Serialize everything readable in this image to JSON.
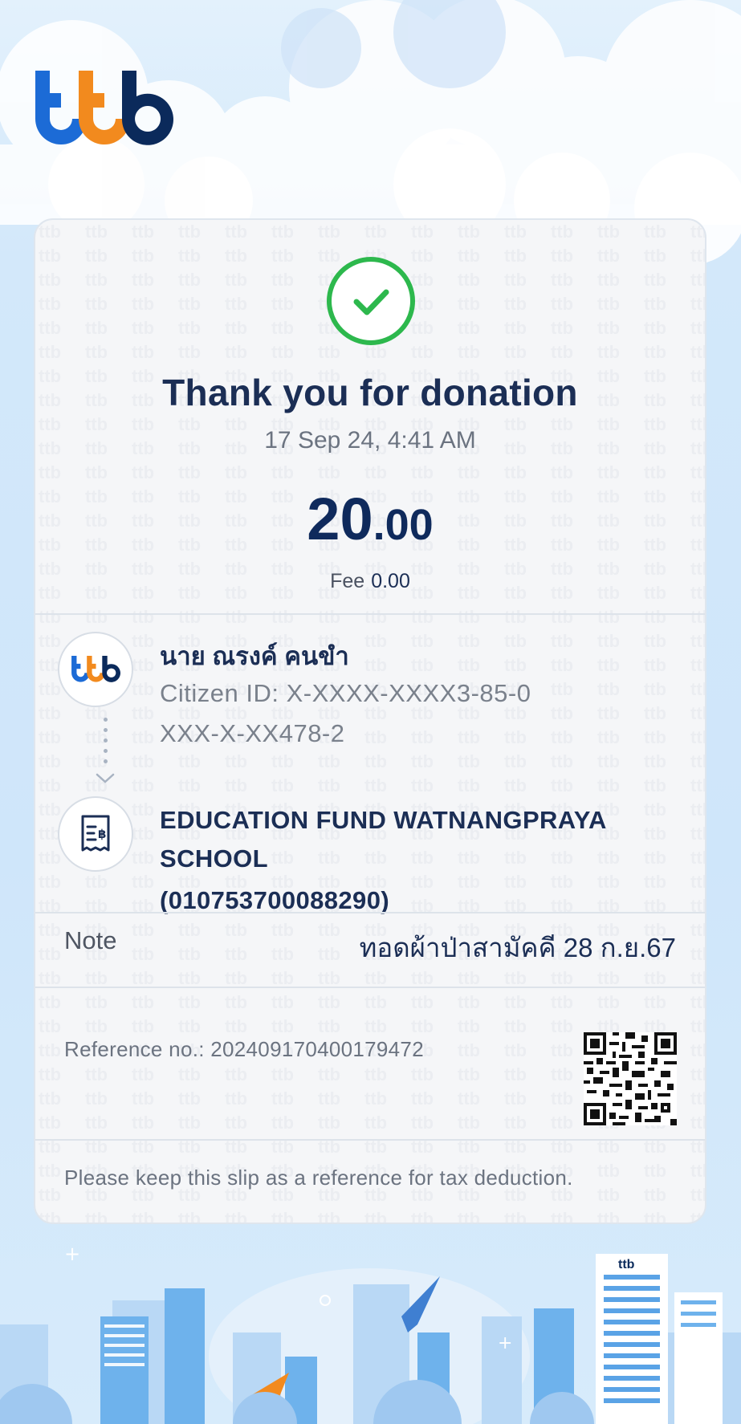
{
  "brand": {
    "logo": "ttb",
    "primary_color": "#0b2a5b",
    "accent_color": "#f28a1e",
    "blue_color": "#1c6bd6"
  },
  "slip": {
    "status_icon": "check-circle-icon",
    "title": "Thank you for donation",
    "datetime": "17 Sep 24, 4:41 AM",
    "amount_int": "20",
    "amount_dec": ".00",
    "fee_label": "Fee",
    "fee_value": "0.00"
  },
  "sender": {
    "avatar_logo": "ttb",
    "name": "นาย ณรงค์ คนขำ",
    "citizen_id": "Citizen ID: X-XXXX-XXXX3-85-0",
    "account": "XXX-X-XX478-2"
  },
  "receiver": {
    "icon": "receipt-icon",
    "name": "EDUCATION FUND WATNANGPRAYA SCHOOL",
    "id": "(010753700088290)"
  },
  "note": {
    "label": "Note",
    "value": "ทอดผ้าป่าสามัคคี 28 ก.ย.67"
  },
  "reference": {
    "label": "Reference no.: 202409170400179472",
    "qr_icon": "qr-code-icon"
  },
  "footer": {
    "text": "Please keep this slip as a reference for tax deduction."
  }
}
